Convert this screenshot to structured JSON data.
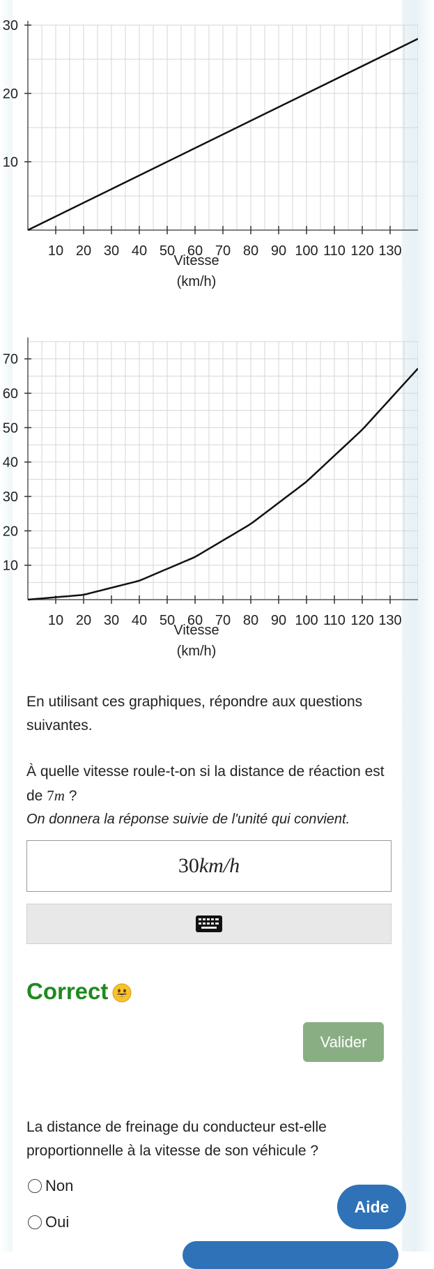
{
  "chart_data": [
    {
      "type": "line",
      "title": "",
      "xlabel": "Vitesse (km/h)",
      "ylabel": "",
      "x_ticks": [
        "10",
        "20",
        "30",
        "40",
        "50",
        "60",
        "70",
        "80",
        "90",
        "100",
        "110",
        "120",
        "130"
      ],
      "y_ticks": [
        "10",
        "20",
        "30"
      ],
      "xlim": [
        0,
        140
      ],
      "ylim": [
        0,
        30
      ],
      "grid": true,
      "series": [
        {
          "x": [
            0,
            140
          ],
          "y": [
            0,
            28
          ]
        }
      ]
    },
    {
      "type": "line",
      "title": "",
      "xlabel": "Vitesse (km/h)",
      "ylabel": "",
      "x_ticks": [
        "10",
        "20",
        "30",
        "40",
        "50",
        "60",
        "70",
        "80",
        "90",
        "100",
        "110",
        "120",
        "130"
      ],
      "y_ticks": [
        "10",
        "20",
        "30",
        "40",
        "50",
        "60",
        "70"
      ],
      "xlim": [
        0,
        140
      ],
      "ylim": [
        0,
        75
      ],
      "grid": true,
      "series": [
        {
          "x": [
            0,
            20,
            40,
            60,
            80,
            100,
            120,
            140
          ],
          "y": [
            0,
            1.4,
            5.5,
            12.4,
            22,
            34.3,
            49.4,
            67.2
          ]
        }
      ]
    }
  ],
  "text": {
    "intro": "En utilisant ces graphiques, répondre aux questions suivantes.",
    "question1_prefix": "À quelle vitesse roule-t-on si la distance de réaction est de ",
    "question1_value": "7",
    "question1_unit": "m",
    "question1_suffix": " ?",
    "hint": "On donnera la réponse suivie de l'unité qui convient.",
    "answer_number": "30",
    "answer_unit": "km/h",
    "feedback": "Correct",
    "feedback_emoji": "😀",
    "valider": "Valider",
    "question2": "La distance de freinage du conducteur est-elle proportionnelle à la vitesse de son véhicule ?",
    "option_non": "Non",
    "option_oui": "Oui",
    "aide": "Aide"
  },
  "icons": {
    "keyboard": "keyboard-icon"
  },
  "colors": {
    "correct": "#1f8a1f",
    "valider_bg": "#8aae84",
    "aide_bg": "#2f72b8"
  }
}
